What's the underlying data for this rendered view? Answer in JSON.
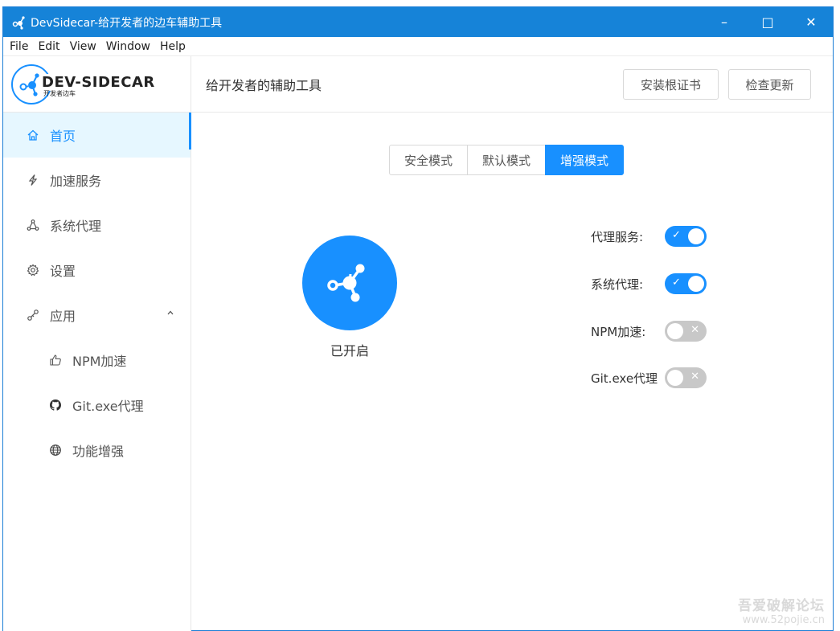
{
  "window": {
    "title": "DevSidecar-给开发者的边车辅助工具",
    "controls": {
      "minimize": "–",
      "maximize": "□",
      "close": "✕"
    }
  },
  "menubar": [
    "File",
    "Edit",
    "View",
    "Window",
    "Help"
  ],
  "logo": {
    "title": "DEV-SIDECAR",
    "subtitle": "开发者边车"
  },
  "header": {
    "title": "给开发者的辅助工具",
    "install_cert_label": "安装根证书",
    "check_update_label": "检查更新"
  },
  "sidebar": {
    "items": [
      {
        "label": "首页",
        "icon": "home-icon",
        "active": true
      },
      {
        "label": "加速服务",
        "icon": "bolt-icon"
      },
      {
        "label": "系统代理",
        "icon": "network-icon"
      },
      {
        "label": "设置",
        "icon": "gear-icon"
      },
      {
        "label": "应用",
        "icon": "app-icon",
        "expanded": true
      },
      {
        "label": "NPM加速",
        "icon": "thumbs-up-icon",
        "sub": true
      },
      {
        "label": "Git.exe代理",
        "icon": "github-icon",
        "sub": true
      },
      {
        "label": "功能增强",
        "icon": "globe-icon",
        "sub": true
      }
    ]
  },
  "modes": {
    "options": [
      "安全模式",
      "默认模式",
      "增强模式"
    ],
    "selected": "增强模式"
  },
  "power": {
    "status": "已开启",
    "on": true
  },
  "toggles": [
    {
      "label": "代理服务:",
      "on": true
    },
    {
      "label": "系统代理:",
      "on": true
    },
    {
      "label": "NPM加速:",
      "on": false
    },
    {
      "label": "Git.exe代理",
      "on": false
    }
  ],
  "switch_marks": {
    "on": "✓",
    "off": "✕"
  },
  "watermark": {
    "line1": "吾爱破解论坛",
    "line2": "www.52pojie.cn"
  },
  "colors": {
    "accent": "#1890ff",
    "titlebar": "#1683d8",
    "switch_off": "#c8c8c8"
  }
}
